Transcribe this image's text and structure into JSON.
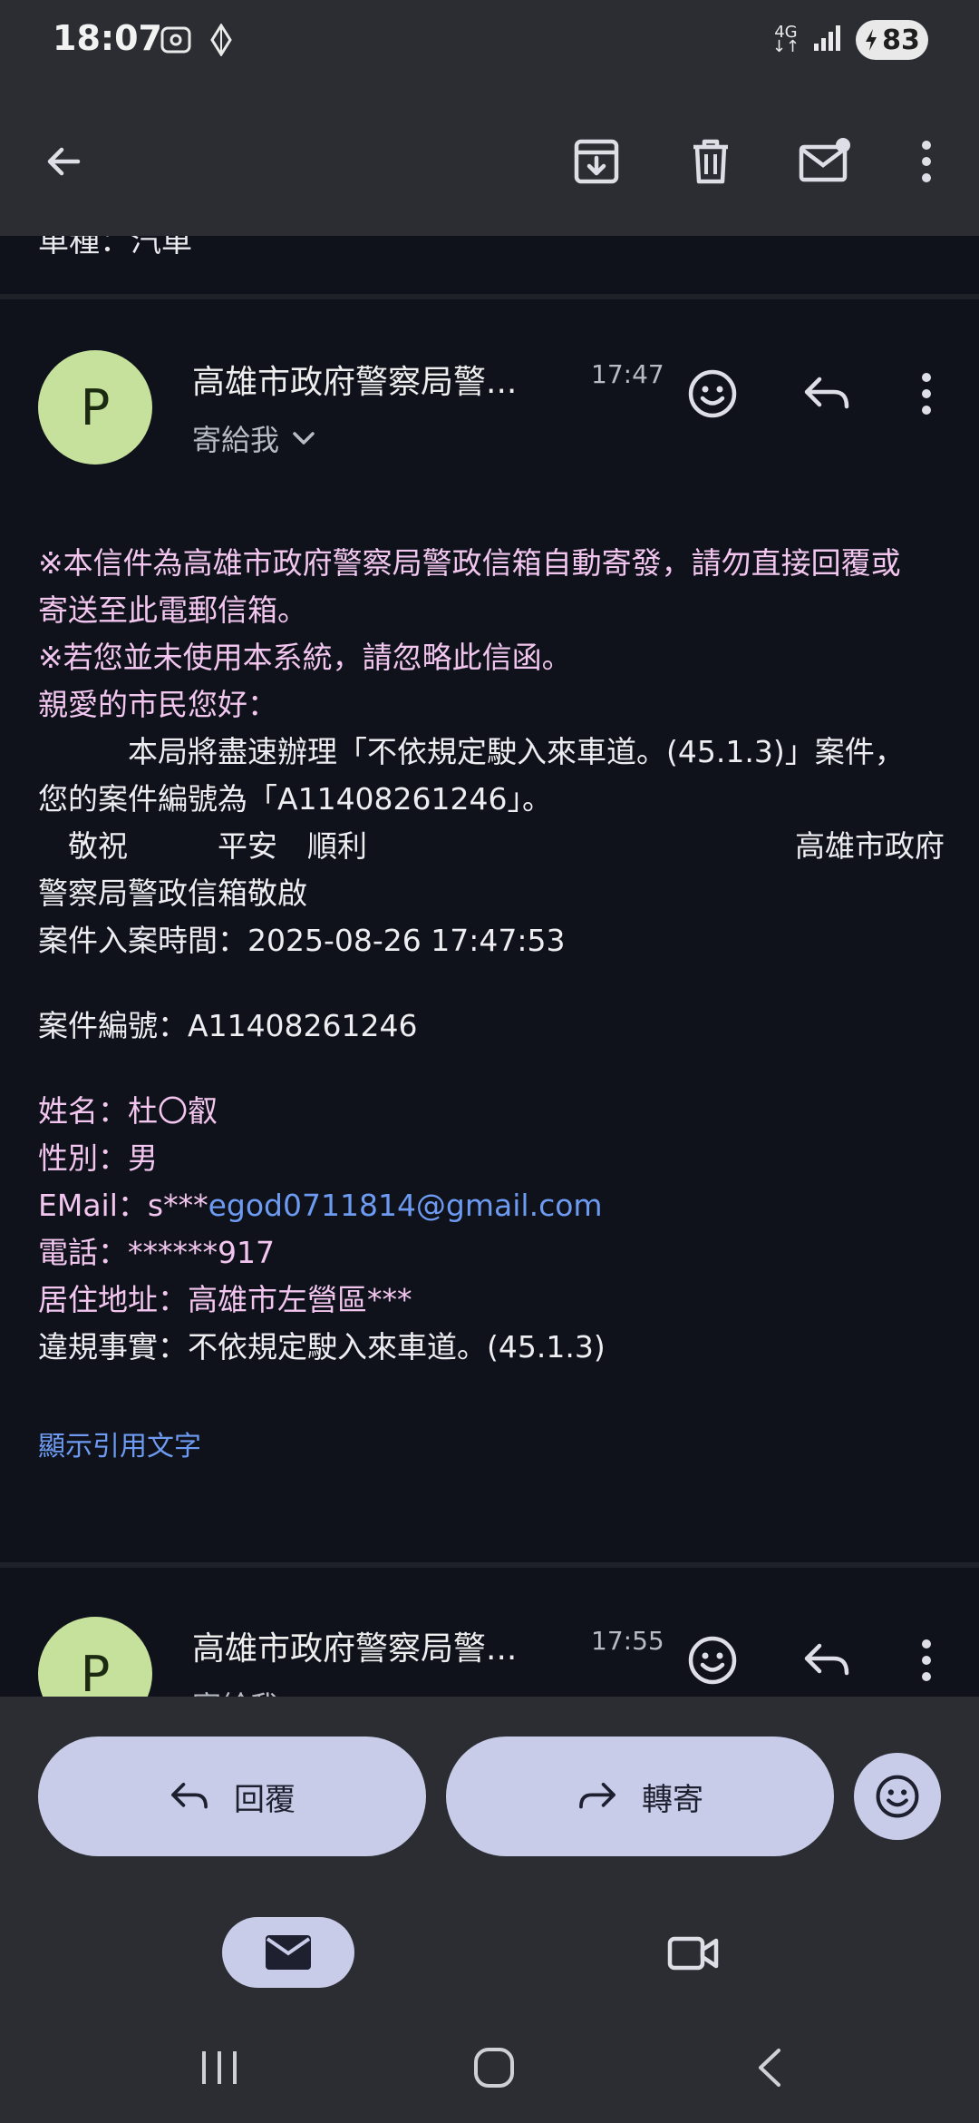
{
  "status_bar": {
    "time": "18:07",
    "network": "4G",
    "battery": "83"
  },
  "toolbar": {
    "back": "arrow-back-icon",
    "archive": "archive-icon",
    "delete": "delete-icon",
    "mark_unread": "mark-unread-icon",
    "more": "more-vert-icon"
  },
  "previous_message_tail": "車種：汽車",
  "messages": [
    {
      "avatar_letter": "P",
      "sender": "高雄市政府警察局警...",
      "time": "17:47",
      "recipient_label": "寄給我",
      "body_lines": [
        "※本信件為高雄市政府警察局警政信箱自動寄發，請勿直接回覆或",
        "寄送至此電郵信箱。",
        "※若您並未使用本系統，請忽略此信函。",
        "親愛的市民您好：",
        "　　　本局將盡速辦理「不依規定駛入來車道。(45.1.3)」案件，",
        "您的案件編號為「A11408261246」。",
        "　敬祝　　　平安　順利",
        "高雄市政府",
        "警察局警政信箱敬啟",
        "案件入案時間：2025-08-26 17:47:53",
        "案件編號：A11408261246",
        "姓名：杜〇叡",
        "性別：男",
        "EMail：s***",
        "egod0711814@gmail.com",
        "電話：******917",
        "居住地址：高雄市左營區***",
        "違規事實：不依規定駛入來車道。(45.1.3)"
      ],
      "show_quoted": "顯示引用文字"
    },
    {
      "avatar_letter": "P",
      "sender": "高雄市政府警察局警...",
      "time": "17:55",
      "recipient_label": "寄給我"
    }
  ],
  "actions": {
    "reply": "回覆",
    "forward": "轉寄"
  },
  "colors": {
    "background": "#0f121a",
    "bar": "#2b2d33",
    "pill": "#c9cce8",
    "avatar": "#c5e19b",
    "pink_text": "#f2c6ef",
    "link": "#6d9bf2"
  }
}
